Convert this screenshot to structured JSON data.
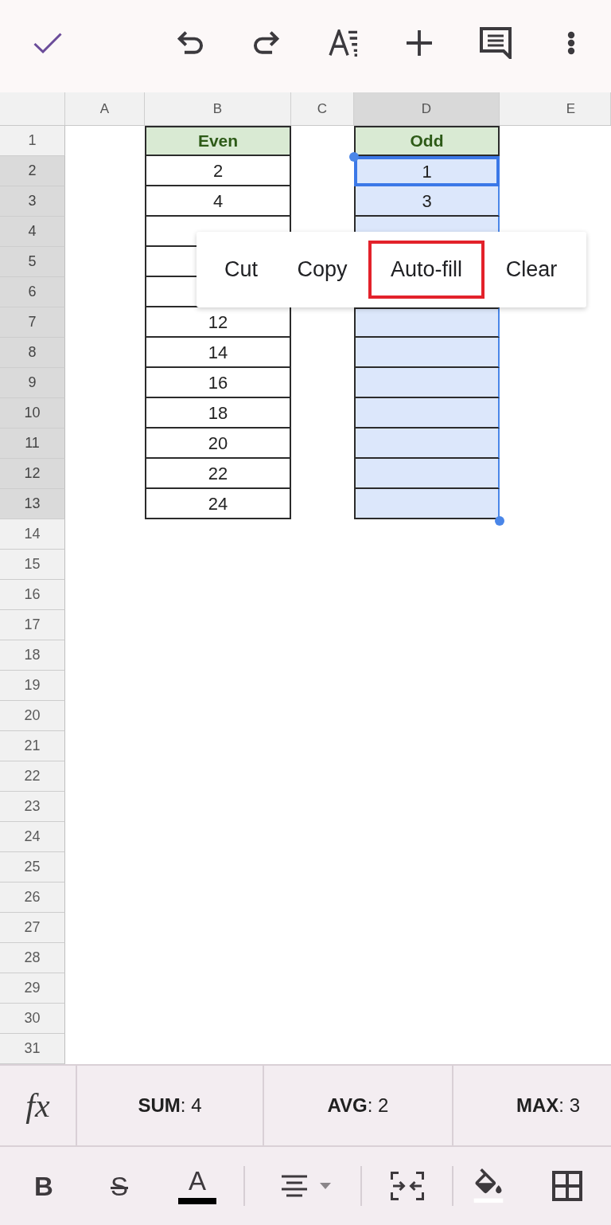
{
  "columns": [
    {
      "label": "A",
      "selected": false
    },
    {
      "label": "B",
      "selected": false
    },
    {
      "label": "C",
      "selected": false
    },
    {
      "label": "D",
      "selected": true
    },
    {
      "label": "E",
      "selected": false
    }
  ],
  "rows": [
    {
      "label": "1",
      "selected": false,
      "b": {
        "kind": "header",
        "text": "Even",
        "selected": false
      },
      "d": {
        "kind": "header",
        "text": "Odd",
        "selected": false,
        "active": false
      }
    },
    {
      "label": "2",
      "selected": true,
      "b": {
        "kind": "value",
        "text": "2",
        "selected": false
      },
      "d": {
        "kind": "value",
        "text": "1",
        "selected": true,
        "active": true
      }
    },
    {
      "label": "3",
      "selected": true,
      "b": {
        "kind": "value",
        "text": "4",
        "selected": false
      },
      "d": {
        "kind": "value",
        "text": "3",
        "selected": true,
        "active": false
      }
    },
    {
      "label": "4",
      "selected": true,
      "b": {
        "kind": "value",
        "selected": false
      },
      "d": {
        "kind": "value",
        "selected": true,
        "active": false
      }
    },
    {
      "label": "5",
      "selected": true,
      "b": {
        "kind": "value",
        "selected": false
      }
    },
    {
      "label": "6",
      "selected": true,
      "b": {
        "kind": "value",
        "selected": false
      }
    },
    {
      "label": "7",
      "selected": true,
      "b": {
        "kind": "value",
        "text": "12",
        "selected": false
      },
      "d": {
        "kind": "value",
        "selected": true,
        "active": false
      }
    },
    {
      "label": "8",
      "selected": true,
      "b": {
        "kind": "value",
        "text": "14",
        "selected": false
      },
      "d": {
        "kind": "value",
        "selected": true,
        "active": false
      }
    },
    {
      "label": "9",
      "selected": true,
      "b": {
        "kind": "value",
        "text": "16",
        "selected": false
      },
      "d": {
        "kind": "value",
        "selected": true,
        "active": false
      }
    },
    {
      "label": "10",
      "selected": true,
      "b": {
        "kind": "value",
        "text": "18",
        "selected": false
      },
      "d": {
        "kind": "value",
        "selected": true,
        "active": false
      }
    },
    {
      "label": "11",
      "selected": true,
      "b": {
        "kind": "value",
        "text": "20",
        "selected": false
      },
      "d": {
        "kind": "value",
        "selected": true,
        "active": false
      }
    },
    {
      "label": "12",
      "selected": true,
      "b": {
        "kind": "value",
        "text": "22",
        "selected": false
      },
      "d": {
        "kind": "value",
        "selected": true,
        "active": false
      }
    },
    {
      "label": "13",
      "selected": true,
      "b": {
        "kind": "value",
        "text": "24",
        "selected": false
      },
      "d": {
        "kind": "value",
        "selected": true,
        "active": false
      }
    },
    {
      "label": "14",
      "selected": false
    },
    {
      "label": "15",
      "selected": false
    },
    {
      "label": "16",
      "selected": false
    },
    {
      "label": "17",
      "selected": false
    },
    {
      "label": "18",
      "selected": false
    },
    {
      "label": "19",
      "selected": false
    },
    {
      "label": "20",
      "selected": false
    },
    {
      "label": "21",
      "selected": false
    },
    {
      "label": "22",
      "selected": false
    },
    {
      "label": "23",
      "selected": false
    },
    {
      "label": "24",
      "selected": false
    },
    {
      "label": "25",
      "selected": false
    },
    {
      "label": "26",
      "selected": false
    },
    {
      "label": "27",
      "selected": false
    },
    {
      "label": "28",
      "selected": false
    },
    {
      "label": "29",
      "selected": false
    },
    {
      "label": "30",
      "selected": false
    },
    {
      "label": "31",
      "selected": false
    }
  ],
  "context_menu": {
    "items": [
      {
        "label": "Cut",
        "highlighted": false
      },
      {
        "label": "Copy",
        "highlighted": false
      },
      {
        "label": "Auto-fill",
        "highlighted": true
      },
      {
        "label": "Clear",
        "highlighted": false
      }
    ]
  },
  "status_bar": {
    "function_glyph": "fx",
    "stats": [
      "**SUM**: 4",
      "**AVG**: 2",
      "**MAX**: 3"
    ]
  },
  "format_bar": {
    "glyph_buttons": [
      {
        "kind": "bold",
        "glyph": "B"
      },
      {
        "kind": "strikethrough",
        "glyph": "S"
      },
      {
        "kind": "text_color",
        "glyph": "A"
      }
    ]
  }
}
